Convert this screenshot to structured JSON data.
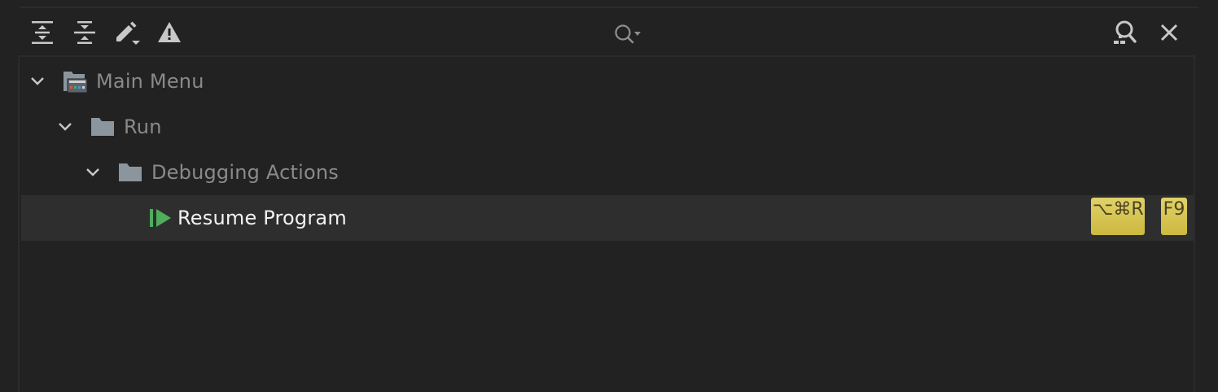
{
  "toolbar": {
    "expand_all": "expand-all-icon",
    "collapse_all": "collapse-all-icon",
    "edit": "edit-shortcut-icon",
    "conflicts": "warning-icon",
    "find_by_shortcut": "find-shortcut-icon",
    "close": "close-icon"
  },
  "search": {
    "value": "",
    "placeholder": ""
  },
  "tree": {
    "nodes": [
      {
        "label": "Main Menu",
        "icon": "menu-folder-icon",
        "expanded": true
      },
      {
        "label": "Run",
        "icon": "folder-icon",
        "expanded": true
      },
      {
        "label": "Debugging Actions",
        "icon": "folder-icon",
        "expanded": true
      },
      {
        "label": "Resume Program",
        "icon": "resume-program-icon",
        "selected": true,
        "shortcuts": [
          "⌥⌘R",
          "F9"
        ]
      }
    ]
  },
  "colors": {
    "background": "#222222",
    "selected_row": "#2e2e2e",
    "shortcut_badge": "#d7c54e",
    "resume_icon": "#4fae5c",
    "folder_icon": "#8b959e"
  }
}
